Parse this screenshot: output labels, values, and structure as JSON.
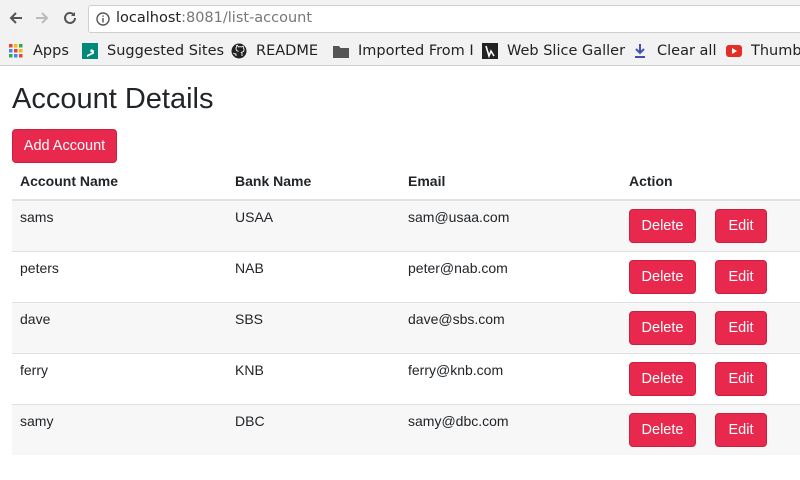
{
  "browser": {
    "url_host": "localhost",
    "url_path": ":8081/list-account",
    "bookmarks": [
      {
        "label": "Apps",
        "icon": "apps-grid-icon"
      },
      {
        "label": "Suggested Sites",
        "icon": "bing-icon"
      },
      {
        "label": "README",
        "icon": "github-icon"
      },
      {
        "label": "Imported From I",
        "icon": "folder-icon"
      },
      {
        "label": "Web Slice Galler",
        "icon": "web-slice-icon"
      },
      {
        "label": "Clear all",
        "icon": "download-icon"
      },
      {
        "label": "Thumb",
        "icon": "youtube-icon"
      }
    ]
  },
  "page": {
    "title": "Account Details",
    "add_button": "Add Account"
  },
  "table": {
    "headers": [
      "Account Name",
      "Bank Name",
      "Email",
      "Action"
    ],
    "rows": [
      {
        "name": "sams",
        "bank": "USAA",
        "email": "sam@usaa.com"
      },
      {
        "name": "peters",
        "bank": "NAB",
        "email": "peter@nab.com"
      },
      {
        "name": "dave",
        "bank": "SBS",
        "email": "dave@sbs.com"
      },
      {
        "name": "ferry",
        "bank": "KNB",
        "email": "ferry@knb.com"
      },
      {
        "name": "samy",
        "bank": "DBC",
        "email": "samy@dbc.com"
      }
    ],
    "delete_label": "Delete",
    "edit_label": "Edit"
  },
  "colors": {
    "accent": "#e8294d",
    "stripe": "#f7f7f7"
  }
}
